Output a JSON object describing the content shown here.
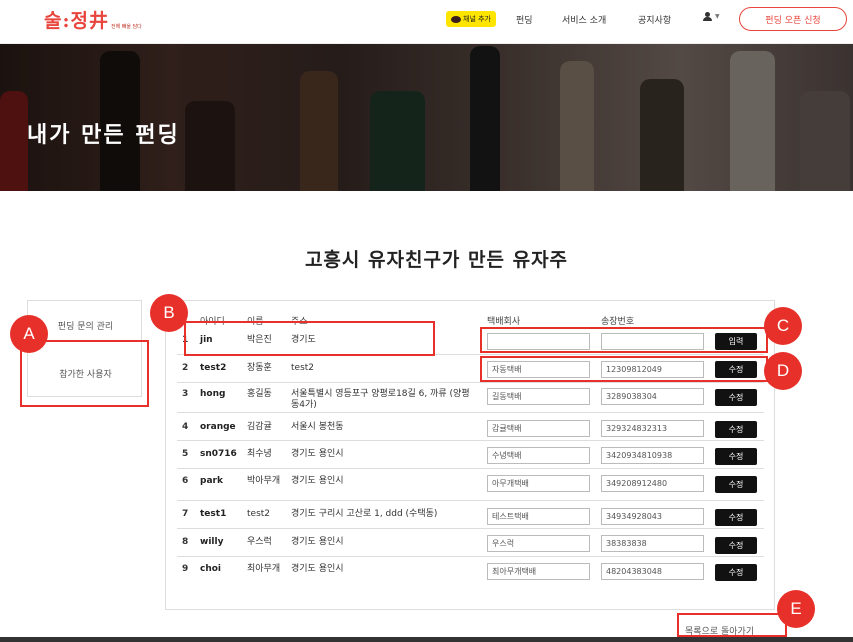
{
  "nav": {
    "logo": "술:정井",
    "logo_tagline": "전해 빼울 담다",
    "kakao_label": "채널 추가",
    "links": [
      "펀딩",
      "서비스 소개",
      "공지사항"
    ],
    "open_button": "펀딩 오픈 신청"
  },
  "hero": {
    "title": "내가 만든 펀딩"
  },
  "funding_title": "고흥시 유자친구가 만든 유자주",
  "side_menu": {
    "items": [
      "펀딩 문의 관리",
      "참가한 사용자"
    ]
  },
  "table": {
    "headers": [
      "아이디",
      "이름",
      "주소",
      "택배회사",
      "송장번호"
    ],
    "rows": [
      {
        "num": "1",
        "id": "jin",
        "name": "박은진",
        "address": "경기도",
        "courier": "",
        "tracking": "",
        "button": "입력"
      },
      {
        "num": "2",
        "id": "test2",
        "name": "장동훈",
        "address": "test2",
        "courier": "자동택배",
        "tracking": "12309812049",
        "button": "수정"
      },
      {
        "num": "3",
        "id": "hong",
        "name": "홍길동",
        "address": "서울특별시 영등포구 양평로18길 6, 까류 (양평동4가)",
        "courier": "길동택배",
        "tracking": "3289038304",
        "button": "수정"
      },
      {
        "num": "4",
        "id": "orange",
        "name": "김감귤",
        "address": "서울시 봉천동",
        "courier": "감귤택배",
        "tracking": "329324832313",
        "button": "수정"
      },
      {
        "num": "5",
        "id": "sn0716",
        "name": "최수녕",
        "address": "경기도 용인시",
        "courier": "수녕택배",
        "tracking": "3420934810938",
        "button": "수정"
      },
      {
        "num": "6",
        "id": "park",
        "name": "박아무개",
        "address": "경기도 용인시",
        "courier": "아무개택배",
        "tracking": "349208912480",
        "button": "수정"
      },
      {
        "num": "7",
        "id": "test1",
        "name": "test2",
        "address": "경기도 구리시 고산로 1, ddd (수택동)",
        "courier": "테스트택배",
        "tracking": "34934928043",
        "button": "수정"
      },
      {
        "num": "8",
        "id": "willy",
        "name": "우스럭",
        "address": "경기도 용인시",
        "courier": "우스럭",
        "tracking": "38383838",
        "button": "수정"
      },
      {
        "num": "9",
        "id": "choi",
        "name": "최아무개",
        "address": "경기도 용인시",
        "courier": "최아무개택배",
        "tracking": "48204383048",
        "button": "수정"
      }
    ]
  },
  "back_link": "목록으로 돌아가기",
  "annotations": [
    "A",
    "B",
    "C",
    "D",
    "E"
  ],
  "colors": {
    "accent": "#e8453c",
    "annotation": "#e8302a",
    "kakao": "#fee500"
  }
}
